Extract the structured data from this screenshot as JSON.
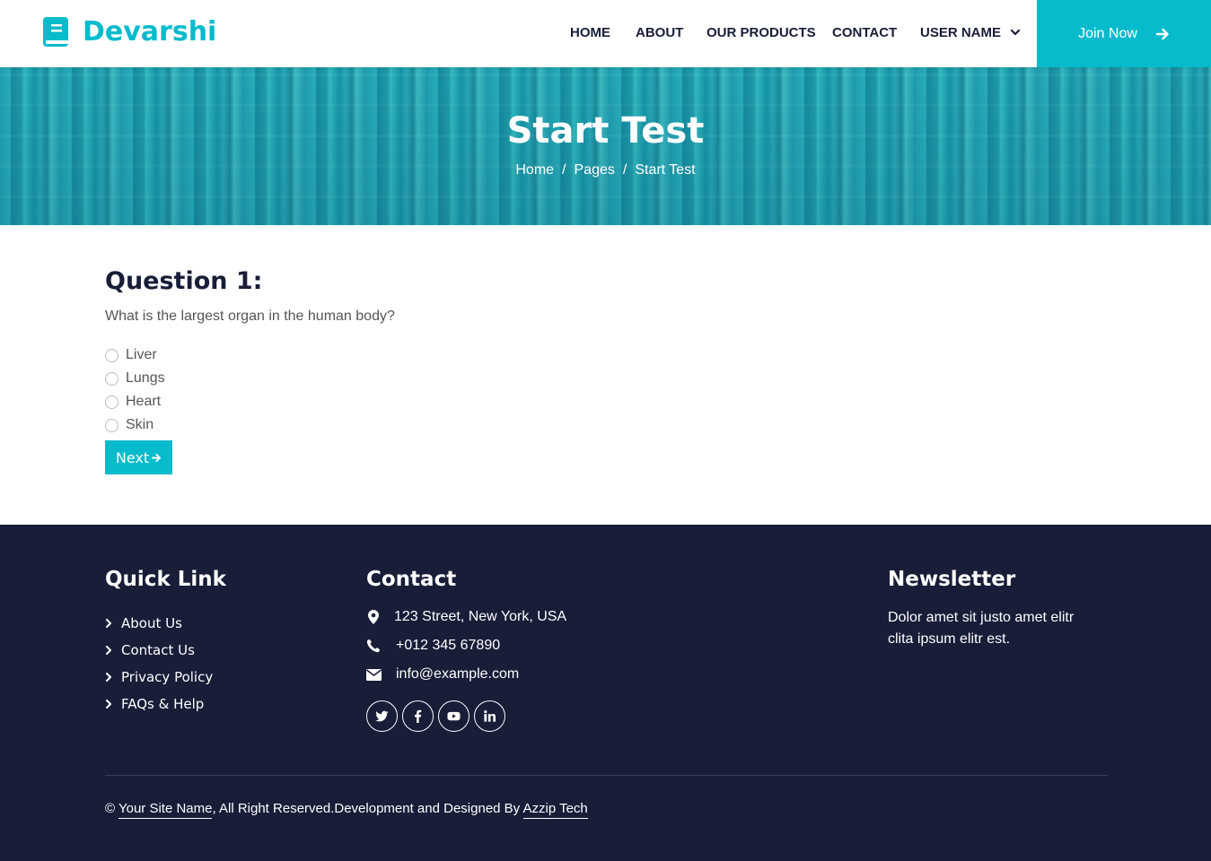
{
  "brand": {
    "name": "Devarshi",
    "icon": "book-icon"
  },
  "nav": {
    "home": "HOME",
    "about": "ABOUT",
    "products": "OUR PRODUCTS",
    "contact": "CONTACT",
    "user": "USER NAME",
    "join": "Join Now"
  },
  "hero": {
    "title": "Start Test",
    "breadcrumb": [
      "Home",
      "Pages",
      "Start Test"
    ],
    "separator": "/"
  },
  "question": {
    "title": "Question 1:",
    "text": "What is the largest organ in the human body?",
    "options": [
      "Liver",
      "Lungs",
      "Heart",
      "Skin"
    ],
    "next_label": "Next"
  },
  "footer": {
    "quick_link": {
      "heading": "Quick Link",
      "items": [
        "About Us",
        "Contact Us",
        "Privacy Policy",
        "FAQs & Help"
      ]
    },
    "contact": {
      "heading": "Contact",
      "address": "123 Street, New York, USA",
      "phone": "+012 345 67890",
      "email": "info@example.com",
      "socials": [
        "twitter-icon",
        "facebook-icon",
        "youtube-icon",
        "linkedin-icon"
      ]
    },
    "newsletter": {
      "heading": "Newsletter",
      "text": "Dolor amet sit justo amet elitr clita ipsum elitr est."
    },
    "copyright": {
      "symbol": "©",
      "site": "Your Site Name",
      "middle": ", All Right Reserved.Development and Designed By",
      "designer": "Azzip Tech"
    }
  },
  "colors": {
    "primary": "#06bbcc",
    "dark": "#181d38",
    "text": "#52565b"
  }
}
